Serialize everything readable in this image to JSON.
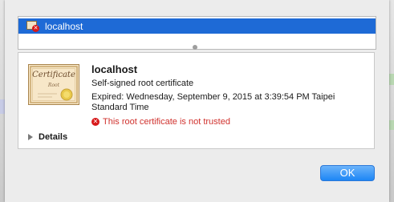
{
  "window": {
    "accent_color": "#1e6ad6",
    "error_color": "#d0312d"
  },
  "certificate_list": {
    "items": [
      {
        "label": "localhost",
        "icon": "certificate-error-icon",
        "selected": true
      }
    ]
  },
  "details": {
    "certificate_image_text": "Certificate",
    "certificate_image_sub": "Root",
    "title": "localhost",
    "subtitle": "Self-signed root certificate",
    "expiry": "Expired: Wednesday, September 9, 2015 at 3:39:54 PM Taipei Standard Time",
    "trust_status": "This root certificate is not trusted",
    "trust_icon": "error-x-icon",
    "details_toggle": "Details"
  },
  "buttons": {
    "ok_label": "OK"
  }
}
